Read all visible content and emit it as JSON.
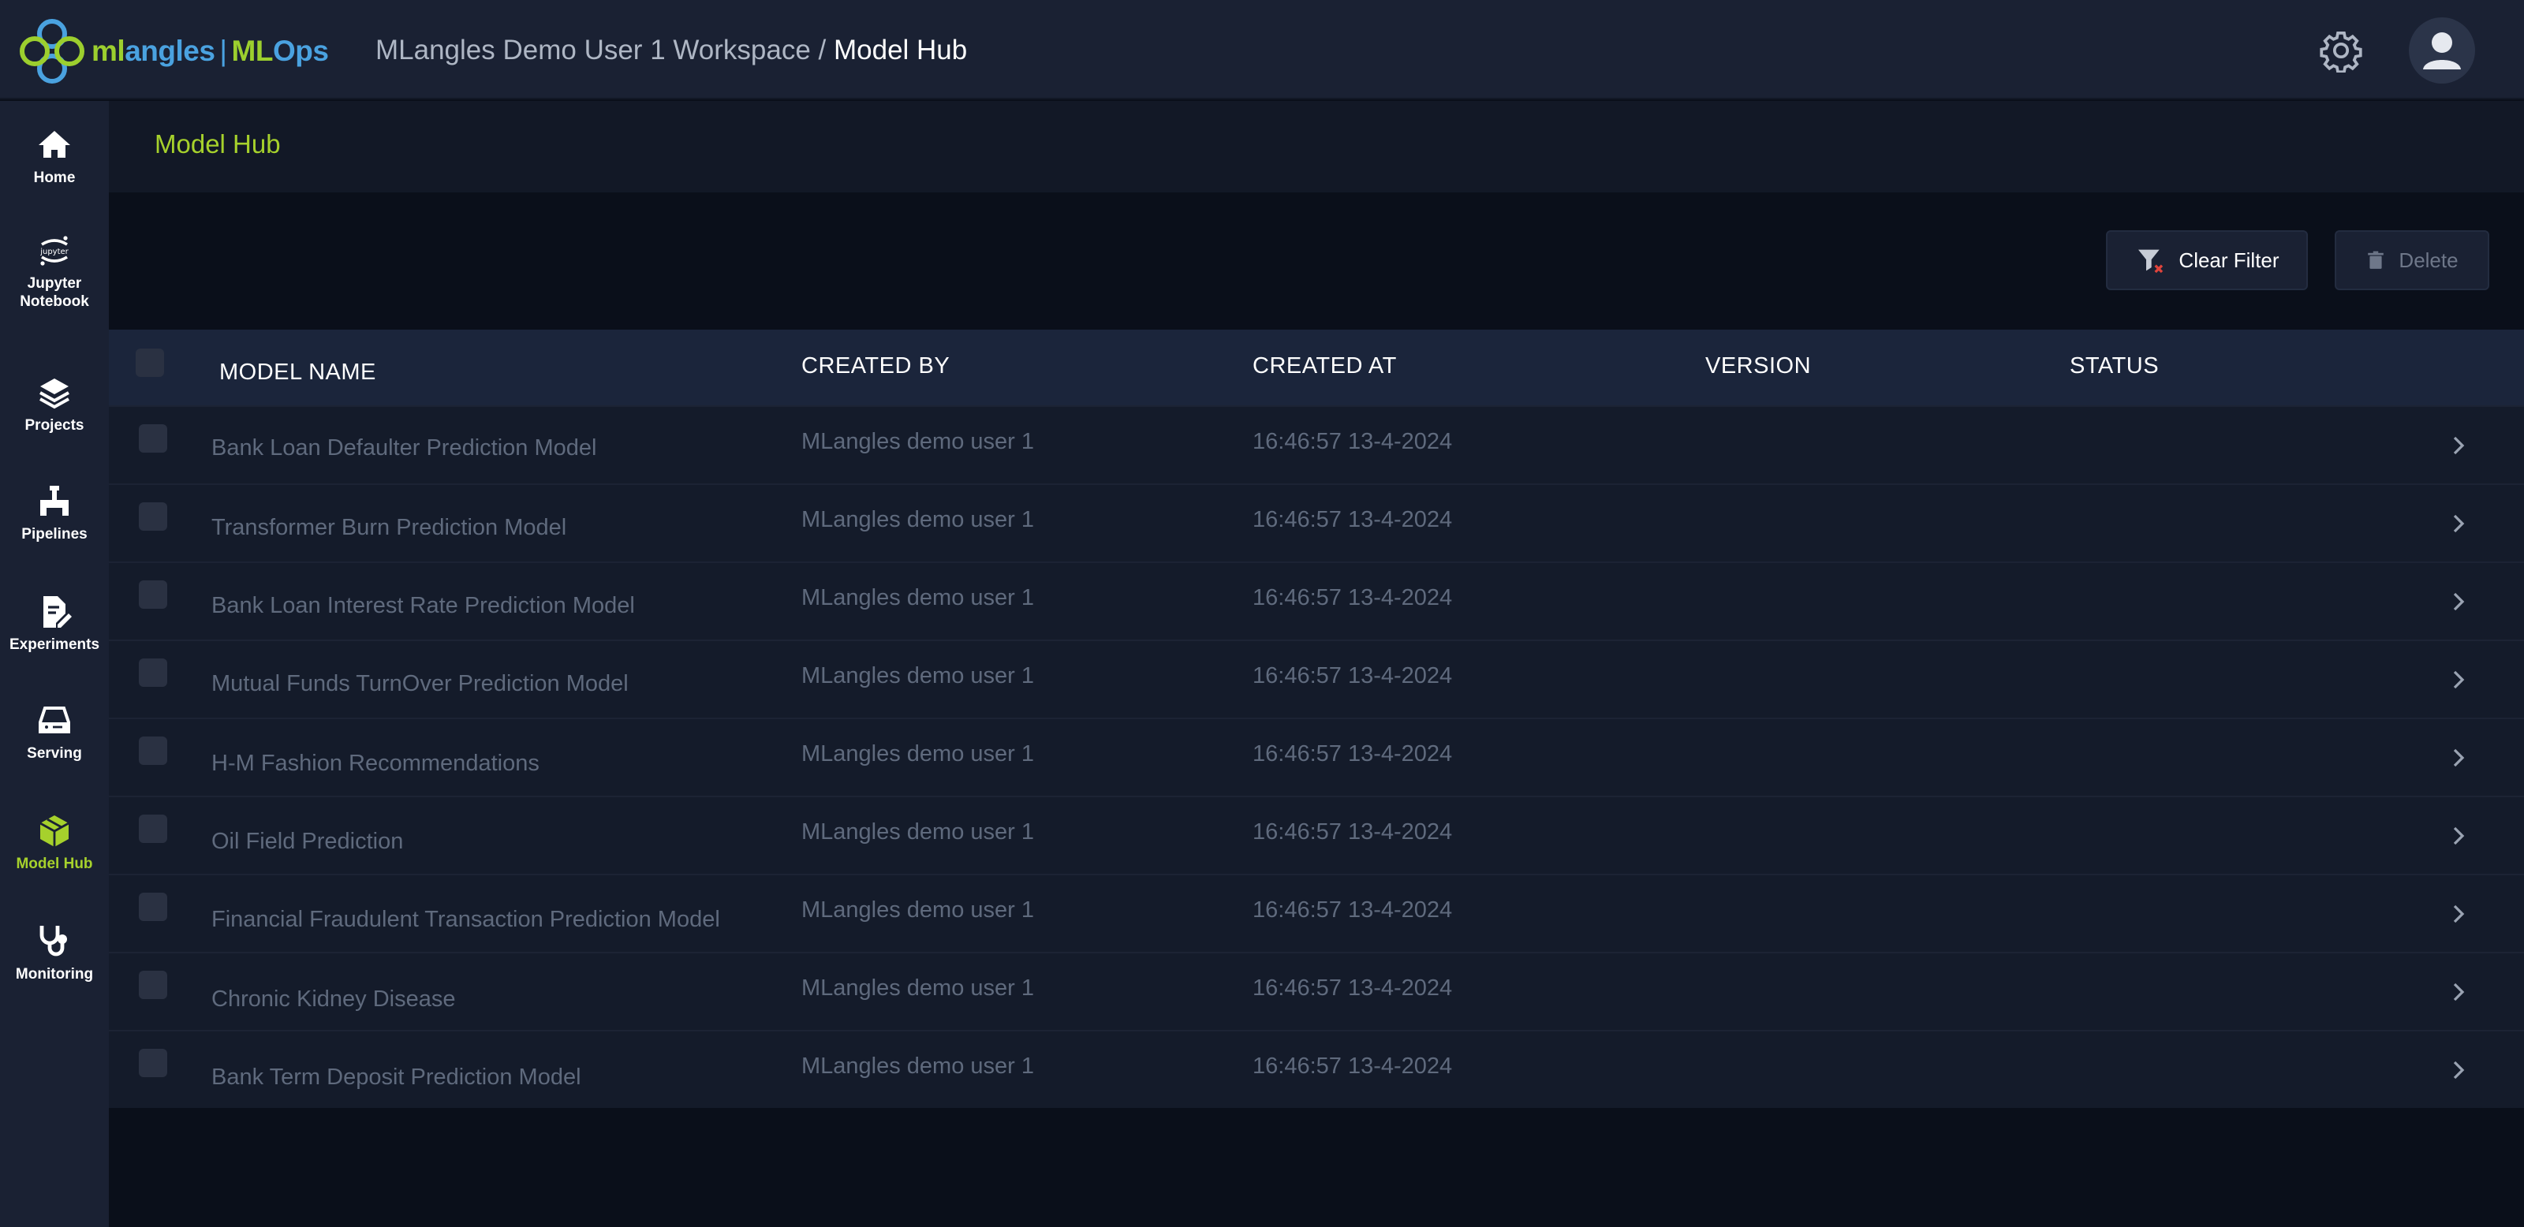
{
  "app": {
    "logo_text_a": "ml",
    "logo_text_b": "angles",
    "logo_sep": "|",
    "logo_text_c": "ML",
    "logo_text_d": "Ops",
    "workspace": "MLangles Demo User 1 Workspace",
    "breadcrumb_sep": " / ",
    "current_page": "Model Hub"
  },
  "sidebar": {
    "items": [
      {
        "label": "Home",
        "icon": "home-icon"
      },
      {
        "label": "Jupyter Notebook",
        "icon": "jupyter-icon"
      },
      {
        "label": "Projects",
        "icon": "layers-icon"
      },
      {
        "label": "Pipelines",
        "icon": "pipeline-icon"
      },
      {
        "label": "Experiments",
        "icon": "experiment-icon"
      },
      {
        "label": "Serving",
        "icon": "serving-icon"
      },
      {
        "label": "Model Hub",
        "icon": "model-hub-icon",
        "active": true
      },
      {
        "label": "Monitoring",
        "icon": "stethoscope-icon"
      }
    ]
  },
  "main": {
    "title": "Model Hub",
    "clear_filter_label": "Clear Filter",
    "delete_label": "Delete"
  },
  "table": {
    "headers": [
      "MODEL NAME",
      "CREATED BY",
      "CREATED AT",
      "VERSION",
      "STATUS"
    ],
    "rows": [
      {
        "name": "Bank Loan Defaulter Prediction Model",
        "created_by": "MLangles demo user 1",
        "created_at": "16:46:57 13-4-2024"
      },
      {
        "name": "Transformer Burn Prediction Model",
        "created_by": "MLangles demo user 1",
        "created_at": "16:46:57 13-4-2024"
      },
      {
        "name": "Bank Loan Interest Rate Prediction Model",
        "created_by": "MLangles demo user 1",
        "created_at": "16:46:57 13-4-2024"
      },
      {
        "name": "Mutual Funds TurnOver Prediction Model",
        "created_by": "MLangles demo user 1",
        "created_at": "16:46:57 13-4-2024"
      },
      {
        "name": "H-M Fashion Recommendations",
        "created_by": "MLangles demo user 1",
        "created_at": "16:46:57 13-4-2024"
      },
      {
        "name": "Oil Field Prediction",
        "created_by": "MLangles demo user 1",
        "created_at": "16:46:57 13-4-2024"
      },
      {
        "name": "Financial Fraudulent Transaction Prediction Model",
        "created_by": "MLangles demo user 1",
        "created_at": "16:46:57 13-4-2024"
      },
      {
        "name": "Chronic Kidney Disease",
        "created_by": "MLangles demo user 1",
        "created_at": "16:46:57 13-4-2024"
      },
      {
        "name": "Bank Term Deposit Prediction Model",
        "created_by": "MLangles demo user 1",
        "created_at": "16:46:57 13-4-2024"
      }
    ]
  },
  "colors": {
    "accent": "#a6d12c",
    "brand_blue": "#4aa2e0",
    "background": "#0a0f1a",
    "panel": "#1a2133"
  }
}
